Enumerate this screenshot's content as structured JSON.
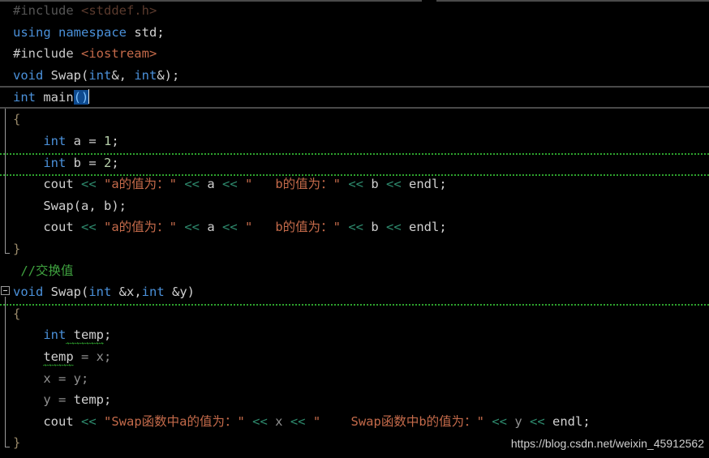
{
  "editor": {
    "app": "visual-studio-code-editor",
    "language": "C++",
    "theme_background": "#000000",
    "current_line_number": 5,
    "selection_text": "()",
    "colors": {
      "keyword": "#4a90d9",
      "string": "#c46a4a",
      "comment": "#3fa23f",
      "number": "#b5cea8",
      "operator": "#2e8b6e",
      "identifier": "#d0d0d0",
      "selection_bg": "#0e4a8f",
      "gutter_line": "#9a9a9a",
      "current_line_border": "#4a4a4a"
    }
  },
  "code": {
    "line1": {
      "directive": "#include",
      "header": " <stddef.h>"
    },
    "line2": {
      "kw_using": "using",
      "kw_namespace": " namespace",
      "std": " std",
      "semi": ";"
    },
    "line3": {
      "directive": "#include",
      "header": " <iostream>"
    },
    "line4": {
      "kw_void": "void",
      "fname": "Swap",
      "open": "(",
      "kw_int1": "int",
      "amp1": "&, ",
      "kw_int2": "int",
      "amp2": "&)",
      "semi": ";"
    },
    "line5": {
      "kw_int": "int",
      "main": " main",
      "parens": "()"
    },
    "line6": {
      "brace": "{"
    },
    "line7": {
      "kw_int": "int",
      "var": " a ",
      "eq": "= ",
      "num": "1",
      "semi": ";"
    },
    "line8": {
      "kw_int": "int",
      "var": " b ",
      "eq": "= ",
      "num": "2",
      "semi": ";"
    },
    "line9": {
      "cout": "cout ",
      "op1": "<< ",
      "str1": "\"a的值为：\"",
      "op2": " << ",
      "var_a": "a",
      "op3": " << ",
      "str2": "\"   b的值为：\"",
      "op4": " << ",
      "var_b": "b",
      "op5": " << ",
      "endl": "endl",
      "semi": ";"
    },
    "line10": {
      "call": "Swap",
      "args": "(a, b);"
    },
    "line11": {
      "cout": "cout ",
      "op1": "<< ",
      "str1": "\"a的值为：\"",
      "op2": " << ",
      "var_a": "a",
      "op3": " << ",
      "str2": "\"   b的值为：\"",
      "op4": " << ",
      "var_b": "b",
      "op5": " << ",
      "endl": "endl",
      "semi": ";"
    },
    "line12": {
      "brace": "}"
    },
    "line13": {
      "comment": "//交换值"
    },
    "line14": {
      "kw_void": "void",
      "fname": "Swap",
      "open": "(",
      "kw_int1": "int",
      "arg1": " &x,",
      "kw_int2": "int",
      "arg2": " &y)"
    },
    "line15": {
      "brace": "{"
    },
    "line16": {
      "kw_int": "int",
      "var": " temp",
      "semi": ";"
    },
    "line17": {
      "var": "temp",
      "rest": " = x;"
    },
    "line18": {
      "stmt": "x = y;"
    },
    "line19": {
      "var": "y = ",
      "temp": "temp",
      "semi": ";"
    },
    "line20": {
      "cout": "cout ",
      "op1": "<< ",
      "str1": "\"Swap函数中a的值为：\"",
      "op2": " << ",
      "var_x": "x",
      "op3": " << ",
      "str2": "\"    Swap函数中b的值为：\"",
      "op4": " << ",
      "var_y": "y",
      "op5": " << ",
      "endl": "endl",
      "semi": ";"
    },
    "line21": {
      "brace": "}"
    }
  },
  "watermark": {
    "url": "https://blog.csdn.net/weixin_45912562"
  }
}
